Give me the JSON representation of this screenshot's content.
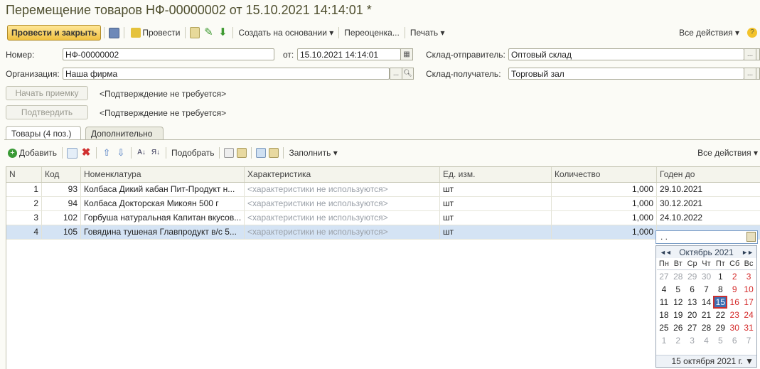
{
  "title": "Перемещение товаров НФ-00000002 от 15.10.2021 14:14:01 *",
  "toolbar": {
    "post_close": "Провести и закрыть",
    "post": "Провести",
    "create_based": "Создать на основании",
    "revaluation": "Переоценка...",
    "print": "Печать",
    "all_actions": "Все действия",
    "help": "?"
  },
  "form": {
    "number_label": "Номер:",
    "number_value": "НФ-00000002",
    "date_label": "от:",
    "date_value": "15.10.2021 14:14:01",
    "sender_label": "Склад-отправитель:",
    "sender_value": "Оптовый склад",
    "org_label": "Организация:",
    "org_value": "Наша фирма",
    "receiver_label": "Склад-получатель:",
    "receiver_value": "Торговый зал",
    "start_receipt": "Начать приемку",
    "confirm": "Подтвердить",
    "no_confirm_1": "<Подтверждение не требуется>",
    "no_confirm_2": "<Подтверждение не требуется>"
  },
  "tabs": [
    {
      "label": "Товары (4 поз.)",
      "active": true
    },
    {
      "label": "Дополнительно",
      "active": false
    }
  ],
  "table_toolbar": {
    "add": "Добавить",
    "pick": "Подобрать",
    "fill": "Заполнить",
    "all_actions": "Все действия"
  },
  "table": {
    "columns": [
      "N",
      "Код",
      "Номенклатура",
      "Характеристика",
      "Ед. изм.",
      "Количество",
      "Годен до"
    ],
    "rows": [
      {
        "n": "1",
        "code": "93",
        "name": "Колбаса Дикий кабан Пит-Продукт н...",
        "char": "<характеристики не используются>",
        "unit": "шт",
        "qty": "1,000",
        "exp": "29.10.2021"
      },
      {
        "n": "2",
        "code": "94",
        "name": "Колбаса Докторская Микоян 500 г",
        "char": "<характеристики не используются>",
        "unit": "шт",
        "qty": "1,000",
        "exp": "30.12.2021"
      },
      {
        "n": "3",
        "code": "102",
        "name": "Горбуша натуральная Капитан вкусов...",
        "char": "<характеристики не используются>",
        "unit": "шт",
        "qty": "1,000",
        "exp": "24.10.2022"
      },
      {
        "n": "4",
        "code": "105",
        "name": "Говядина тушеная Главпродукт в/с 5...",
        "char": "<характеристики не используются>",
        "unit": "шт",
        "qty": "1,000",
        "exp": ""
      }
    ],
    "edit_value": " .  ."
  },
  "calendar": {
    "month": "Октябрь 2021",
    "prev": "◄◄",
    "next": "►►",
    "weekdays": [
      "Пн",
      "Вт",
      "Ср",
      "Чт",
      "Пт",
      "Сб",
      "Вс"
    ],
    "days": [
      [
        "27",
        "28",
        "29",
        "30",
        "1",
        "2",
        "3"
      ],
      [
        "4",
        "5",
        "6",
        "7",
        "8",
        "9",
        "10"
      ],
      [
        "11",
        "12",
        "13",
        "14",
        "15",
        "16",
        "17"
      ],
      [
        "18",
        "19",
        "20",
        "21",
        "22",
        "23",
        "24"
      ],
      [
        "25",
        "26",
        "27",
        "28",
        "29",
        "30",
        "31"
      ],
      [
        "1",
        "2",
        "3",
        "4",
        "5",
        "6",
        "7"
      ]
    ],
    "selected": "15",
    "footer": "15 октября 2021 г."
  },
  "colors": {
    "title": "#4f4f2f",
    "primary": "#f0c040",
    "selected_row": "#d4e3f4",
    "weekend": "#d42a2a",
    "today": "#3d6fb3"
  }
}
